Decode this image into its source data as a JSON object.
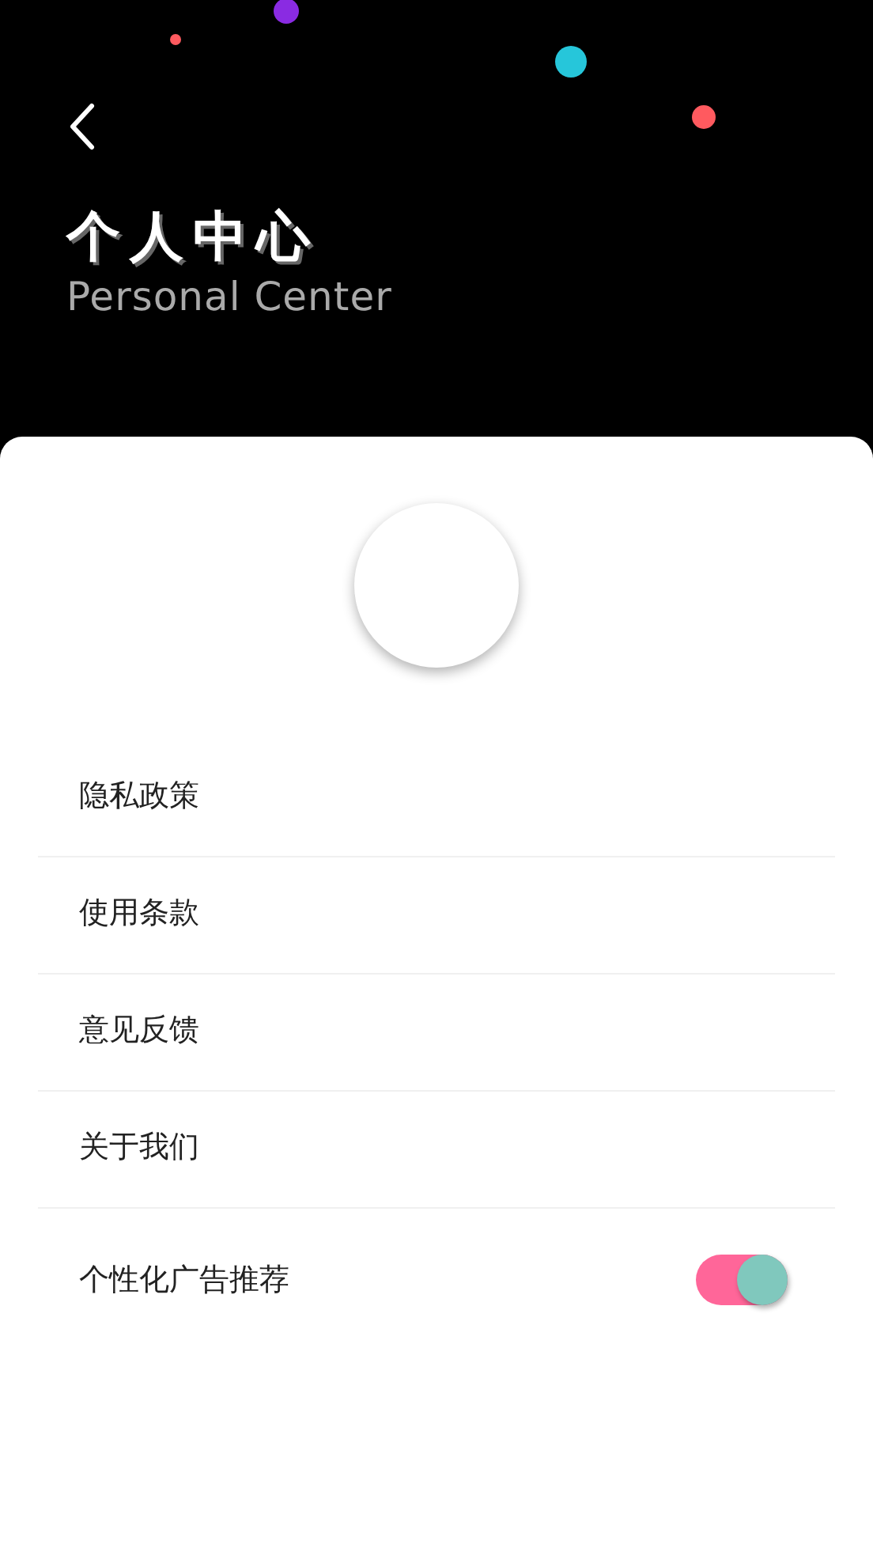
{
  "header": {
    "title": "个人中心",
    "subtitle": "Personal Center"
  },
  "menu": [
    {
      "kind": "link",
      "label": "隐私政策"
    },
    {
      "kind": "link",
      "label": "使用条款"
    },
    {
      "kind": "link",
      "label": "意见反馈"
    },
    {
      "kind": "link",
      "label": "关于我们"
    },
    {
      "kind": "toggle",
      "label": "个性化广告推荐",
      "on": true
    }
  ]
}
